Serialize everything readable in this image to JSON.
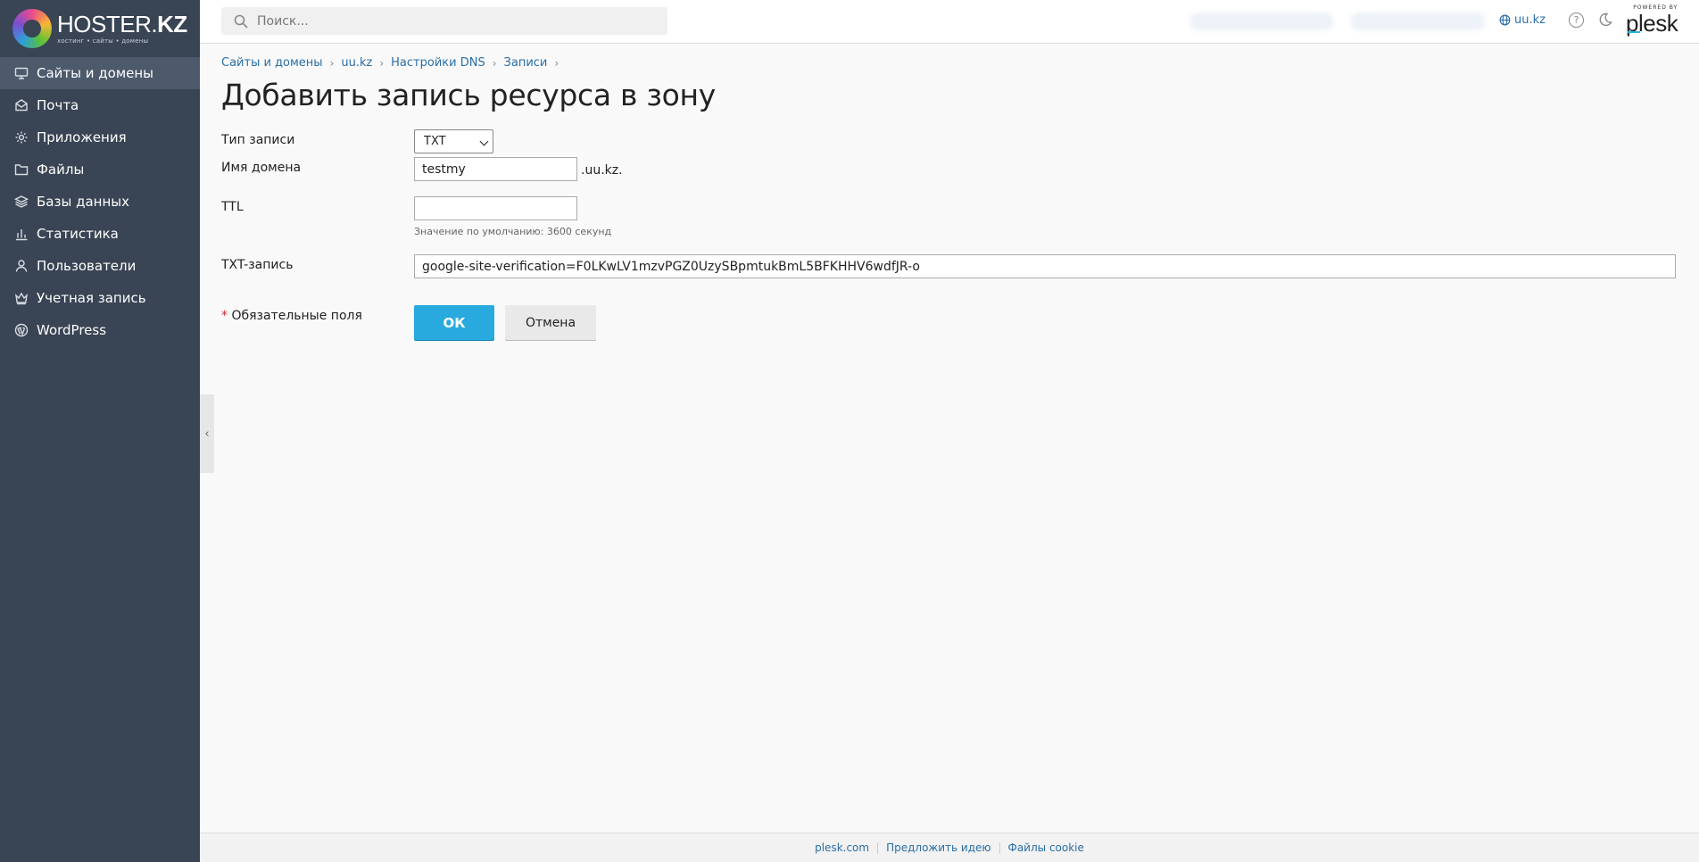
{
  "brand": {
    "name_light": "HOSTER.",
    "name_bold": "KZ",
    "tagline": "хостинг • сайты • домены"
  },
  "sidebar": {
    "items": [
      {
        "label": "Сайты и домены",
        "icon": "monitor-icon",
        "active": true
      },
      {
        "label": "Почта",
        "icon": "mail-icon"
      },
      {
        "label": "Приложения",
        "icon": "gear-icon"
      },
      {
        "label": "Файлы",
        "icon": "folder-icon"
      },
      {
        "label": "Базы данных",
        "icon": "layers-icon"
      },
      {
        "label": "Статистика",
        "icon": "bar-chart-icon"
      },
      {
        "label": "Пользователи",
        "icon": "user-icon"
      },
      {
        "label": "Учетная запись",
        "icon": "crown-icon"
      },
      {
        "label": "WordPress",
        "icon": "wordpress-icon"
      }
    ]
  },
  "header": {
    "search_placeholder": "Поиск...",
    "domain": "uu.kz",
    "help_glyph": "?",
    "plesk_powered": "POWERED BY",
    "plesk_name": "plesk"
  },
  "breadcrumb": [
    "Сайты и домены",
    "uu.kz",
    "Настройки DNS",
    "Записи"
  ],
  "page_title": "Добавить запись ресурса в зону",
  "form": {
    "record_type_label": "Тип записи",
    "record_type_value": "TXT",
    "domain_label": "Имя домена",
    "domain_value": "testmy",
    "domain_suffix": ".uu.kz.",
    "ttl_label": "TTL",
    "ttl_value": "",
    "ttl_hint": "Значение по умолчанию: 3600 секунд",
    "txt_label": "TXT-запись",
    "txt_value": "google-site-verification=F0LKwLV1mzvPGZ0UzySBpmtukBmL5BFKHHV6wdfJR-o",
    "required_star": "*",
    "required_label": "Обязательные поля",
    "ok_label": "ОК",
    "cancel_label": "Отмена"
  },
  "footer": [
    "plesk.com",
    "Предложить идею",
    "Файлы cookie"
  ],
  "colors": {
    "sidebar_bg": "#394454",
    "sidebar_active": "#4c5a6c",
    "primary_button": "#28aadf",
    "link": "#2a6ea5"
  }
}
